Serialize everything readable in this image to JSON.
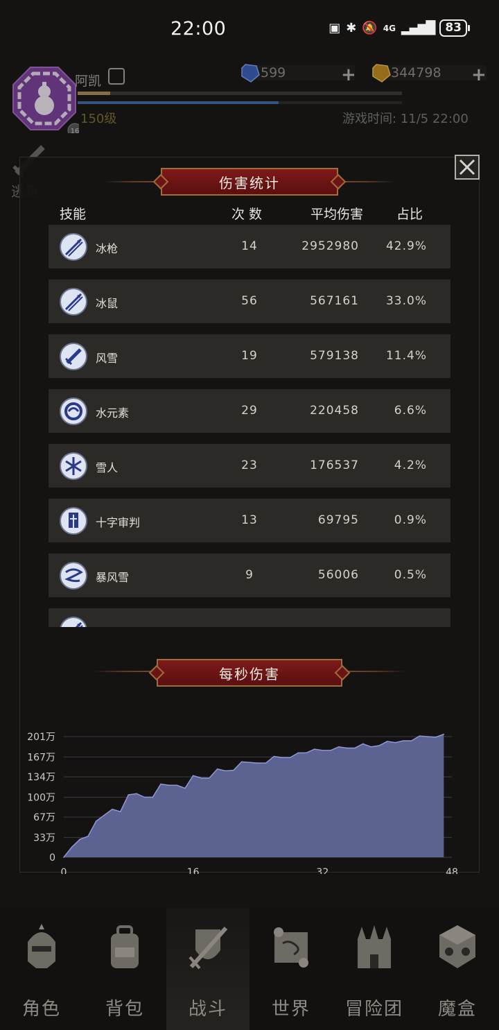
{
  "status_bar": {
    "time": "22:00",
    "battery": "83",
    "network": "4G"
  },
  "player": {
    "name": "阿凯",
    "level": "150级",
    "badge": "16",
    "exp_fraction": 0.1,
    "mp_fraction": 0.62,
    "blue_currency": "599",
    "gold_currency": "344798",
    "game_time": "游戏时间: 11/5 22:00",
    "retreat_label": "逃跑"
  },
  "damage_stats": {
    "title": "伤害统计",
    "headers": {
      "skill": "技能",
      "count": "次 数",
      "avg": "平均伤害",
      "ratio": "占比"
    },
    "rows": [
      {
        "name": "冰枪",
        "count": "14",
        "avg": "2952980",
        "ratio": "42.9%",
        "icon": "ice-spear-icon"
      },
      {
        "name": "冰鼠",
        "count": "56",
        "avg": "567161",
        "ratio": "33.0%",
        "icon": "ice-rat-icon"
      },
      {
        "name": "风雪",
        "count": "19",
        "avg": "579138",
        "ratio": "11.4%",
        "icon": "blizzard-sword-icon"
      },
      {
        "name": "水元素",
        "count": "29",
        "avg": "220458",
        "ratio": "6.6%",
        "icon": "water-elemental-icon"
      },
      {
        "name": "雪人",
        "count": "23",
        "avg": "176537",
        "ratio": "4.2%",
        "icon": "snowflake-icon"
      },
      {
        "name": "十字审判",
        "count": "13",
        "avg": "69795",
        "ratio": "0.9%",
        "icon": "cross-judgment-icon"
      },
      {
        "name": "暴风雪",
        "count": "9",
        "avg": "56006",
        "ratio": "0.5%",
        "icon": "storm-icon"
      },
      {
        "name": "",
        "count": "",
        "avg": "",
        "ratio": "",
        "icon": "ice-spear-icon"
      }
    ]
  },
  "dps": {
    "title": "每秒伤害"
  },
  "chart_data": {
    "type": "area",
    "title": "每秒伤害",
    "xlabel": "",
    "ylabel": "",
    "x_ticks": [
      "0",
      "16",
      "32",
      "48"
    ],
    "y_ticks": [
      "0",
      "33万",
      "67万",
      "100万",
      "134万",
      "167万",
      "201万"
    ],
    "xlim": [
      0,
      48
    ],
    "ylim": [
      0,
      201
    ],
    "y_unit": "万",
    "x": [
      0,
      1,
      2,
      3,
      4,
      5,
      6,
      7,
      8,
      9,
      10,
      11,
      12,
      13,
      14,
      15,
      16,
      17,
      18,
      19,
      20,
      21,
      22,
      23,
      24,
      25,
      26,
      27,
      28,
      29,
      30,
      31,
      32,
      33,
      34,
      35,
      36,
      37,
      38,
      39,
      40,
      41,
      42,
      43,
      44,
      45,
      46,
      47
    ],
    "values": [
      0,
      17,
      30,
      35,
      60,
      70,
      80,
      76,
      104,
      106,
      100,
      100,
      122,
      120,
      120,
      115,
      136,
      132,
      132,
      147,
      144,
      145,
      159,
      158,
      157,
      157,
      168,
      166,
      166,
      174,
      174,
      180,
      178,
      178,
      184,
      182,
      182,
      189,
      184,
      186,
      193,
      191,
      194,
      194,
      202,
      201,
      200,
      205
    ],
    "colors": {
      "fill": "#5d6391",
      "stroke": "#8f97d6",
      "grid": "#3a3a46"
    }
  },
  "nav": {
    "items": [
      {
        "label": "角色",
        "icon": "helmet-icon",
        "active": false
      },
      {
        "label": "背包",
        "icon": "backpack-icon",
        "active": false
      },
      {
        "label": "战斗",
        "icon": "sword-shield-icon",
        "active": true
      },
      {
        "label": "世界",
        "icon": "world-map-icon",
        "active": false
      },
      {
        "label": "冒险团",
        "icon": "castle-icon",
        "active": false
      },
      {
        "label": "魔盒",
        "icon": "magic-box-icon",
        "active": false
      }
    ]
  }
}
